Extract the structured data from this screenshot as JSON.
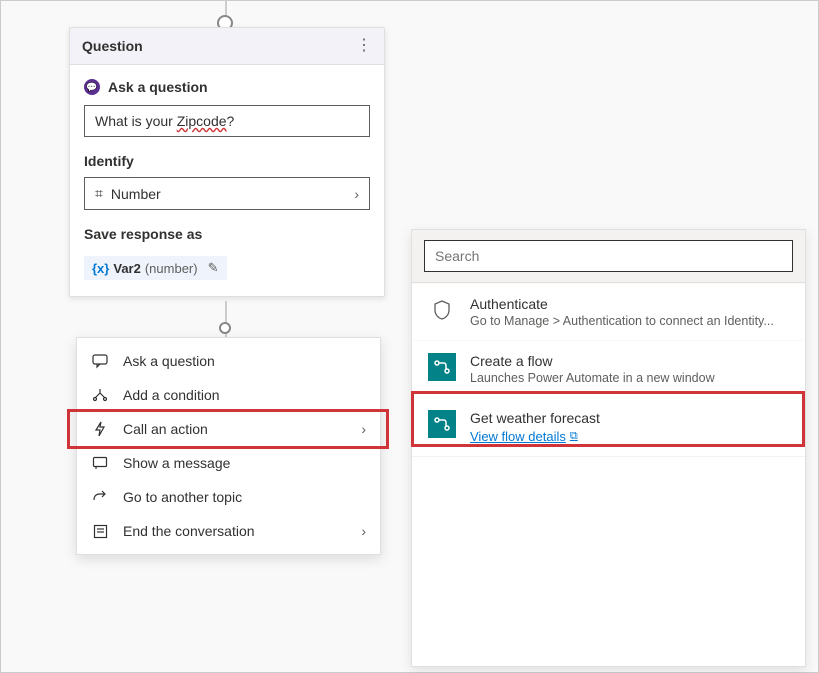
{
  "question_card": {
    "title": "Question",
    "ask_label": "Ask a question",
    "question_text": "What is your Zipcode?",
    "question_prefix": "What is your ",
    "question_zipword": "Zipcode",
    "question_suffix": "?",
    "identify_label": "Identify",
    "identify_value": "Number",
    "save_as_label": "Save response as",
    "var_name": "Var2",
    "var_type": "(number)"
  },
  "actions_menu": {
    "items": [
      {
        "label": "Ask a question",
        "has_chevron": false
      },
      {
        "label": "Add a condition",
        "has_chevron": false
      },
      {
        "label": "Call an action",
        "has_chevron": true,
        "selected": true
      },
      {
        "label": "Show a message",
        "has_chevron": false
      },
      {
        "label": "Go to another topic",
        "has_chevron": false
      },
      {
        "label": "End the conversation",
        "has_chevron": true
      }
    ]
  },
  "action_panel": {
    "search_placeholder": "Search",
    "items": [
      {
        "title": "Authenticate",
        "subtitle": "Go to Manage > Authentication to connect an Identity...",
        "icon": "shield"
      },
      {
        "title": "Create a flow",
        "subtitle": "Launches Power Automate in a new window",
        "icon": "flow"
      },
      {
        "title": "Get weather forecast",
        "link_text": "View flow details",
        "icon": "flow",
        "highlighted": true
      }
    ]
  }
}
